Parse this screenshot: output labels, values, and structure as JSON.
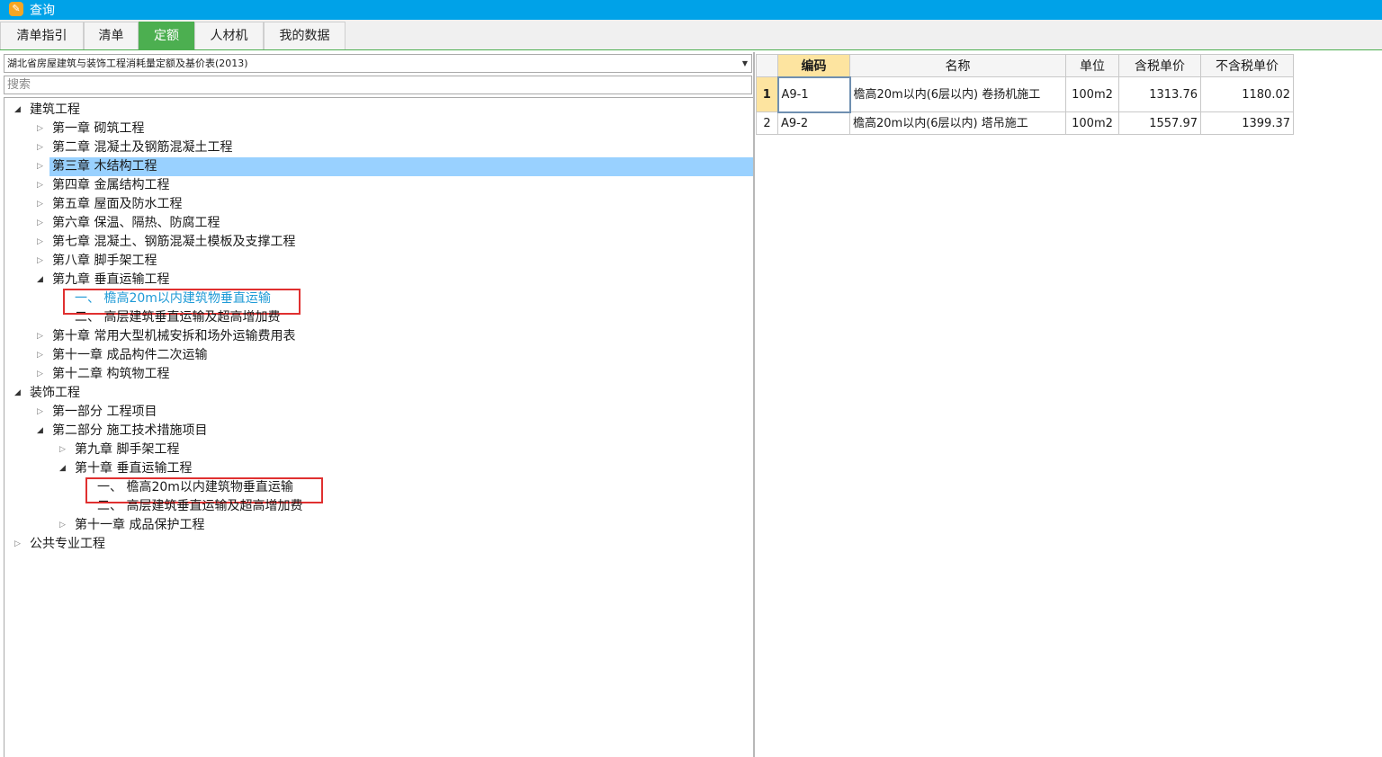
{
  "window": {
    "title": "查询",
    "icon": "app-logo-icon"
  },
  "tabs": [
    {
      "label": "清单指引",
      "active": false
    },
    {
      "label": "清单",
      "active": false
    },
    {
      "label": "定额",
      "active": true
    },
    {
      "label": "人材机",
      "active": false
    },
    {
      "label": "我的数据",
      "active": false
    }
  ],
  "library": {
    "selected": "湖北省房屋建筑与装饰工程消耗量定额及基价表(2013)"
  },
  "search": {
    "placeholder": "搜索",
    "value": ""
  },
  "tree": [
    {
      "label": "建筑工程",
      "depth": 0,
      "toggle": "expanded"
    },
    {
      "label": "第一章  砌筑工程",
      "depth": 1,
      "toggle": "collapsed"
    },
    {
      "label": "第二章  混凝土及钢筋混凝土工程",
      "depth": 1,
      "toggle": "collapsed"
    },
    {
      "label": "第三章  木结构工程",
      "depth": 1,
      "toggle": "collapsed",
      "selected": true
    },
    {
      "label": "第四章  金属结构工程",
      "depth": 1,
      "toggle": "collapsed"
    },
    {
      "label": "第五章  屋面及防水工程",
      "depth": 1,
      "toggle": "collapsed"
    },
    {
      "label": "第六章  保温、隔热、防腐工程",
      "depth": 1,
      "toggle": "collapsed"
    },
    {
      "label": "第七章  混凝土、钢筋混凝土模板及支撑工程",
      "depth": 1,
      "toggle": "collapsed"
    },
    {
      "label": "第八章  脚手架工程",
      "depth": 1,
      "toggle": "collapsed"
    },
    {
      "label": "第九章  垂直运输工程",
      "depth": 1,
      "toggle": "expanded"
    },
    {
      "label": "一、  檐高20m以内建筑物垂直运输",
      "depth": 2,
      "toggle": "none",
      "link": true,
      "boxed": true
    },
    {
      "label": "二、  高层建筑垂直运输及超高增加费",
      "depth": 2,
      "toggle": "none"
    },
    {
      "label": "第十章  常用大型机械安拆和场外运输费用表",
      "depth": 1,
      "toggle": "collapsed"
    },
    {
      "label": "第十一章  成品构件二次运输",
      "depth": 1,
      "toggle": "collapsed"
    },
    {
      "label": "第十二章  构筑物工程",
      "depth": 1,
      "toggle": "collapsed"
    },
    {
      "label": "装饰工程",
      "depth": 0,
      "toggle": "expanded"
    },
    {
      "label": "第一部分  工程项目",
      "depth": 1,
      "toggle": "collapsed"
    },
    {
      "label": "第二部分  施工技术措施项目",
      "depth": 1,
      "toggle": "expanded"
    },
    {
      "label": "第九章  脚手架工程",
      "depth": 2,
      "toggle": "collapsed"
    },
    {
      "label": "第十章  垂直运输工程",
      "depth": 2,
      "toggle": "expanded"
    },
    {
      "label": "一、  檐高20m以内建筑物垂直运输",
      "depth": 3,
      "toggle": "none",
      "boxed": true
    },
    {
      "label": "二、  高层建筑垂直运输及超高增加费",
      "depth": 3,
      "toggle": "none"
    },
    {
      "label": "第十一章  成品保护工程",
      "depth": 2,
      "toggle": "collapsed"
    },
    {
      "label": "公共专业工程",
      "depth": 0,
      "toggle": "collapsed"
    }
  ],
  "grid": {
    "headers": {
      "rownum": "",
      "code": "编码",
      "name": "名称",
      "unit": "单位",
      "tax_price": "含税单价",
      "notax_price": "不含税单价"
    },
    "rows": [
      {
        "rownum": "1",
        "code": "A9-1",
        "name": "檐高20m以内(6层以内) 卷扬机施工",
        "unit": "100m2",
        "tax_price": "1313.76",
        "notax_price": "1180.02"
      },
      {
        "rownum": "2",
        "code": "A9-2",
        "name": "檐高20m以内(6层以内) 塔吊施工",
        "unit": "100m2",
        "tax_price": "1557.97",
        "notax_price": "1399.37"
      }
    ]
  },
  "colors": {
    "titlebar": "#00a2e8",
    "active_tab": "#4caf50",
    "selection": "#99d1ff",
    "link_text": "#1e9ad6",
    "highlight_box": "#e03030",
    "header_current": "#fde4a0"
  }
}
